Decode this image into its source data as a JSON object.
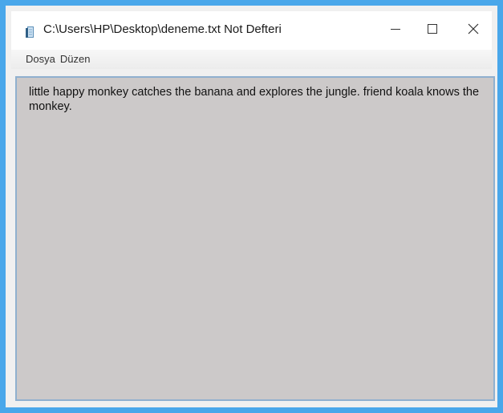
{
  "window": {
    "title": "C:\\Users\\HP\\Desktop\\deneme.txt Not Defteri",
    "app_icon": "notepad-icon",
    "controls": {
      "minimize_icon": "minimize-icon",
      "maximize_icon": "maximize-icon",
      "close_icon": "close-icon"
    }
  },
  "menu": {
    "items": [
      {
        "label": "Dosya"
      },
      {
        "label": "Düzen"
      }
    ]
  },
  "editor": {
    "content": "little happy monkey catches the banana and explores the jungle. friend koala knows the monkey."
  },
  "colors": {
    "window_border": "#49a7ea",
    "editor_background": "#ccc9c9",
    "editor_border": "#8fb0cf"
  }
}
